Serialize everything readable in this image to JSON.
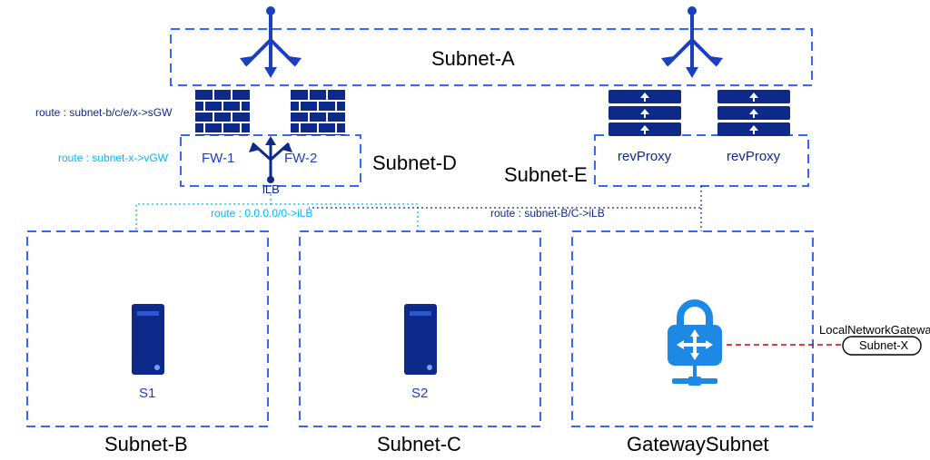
{
  "labels": {
    "subnetA": "Subnet-A",
    "subnetB": "Subnet-B",
    "subnetC": "Subnet-C",
    "subnetD": "Subnet-D",
    "subnetE": "Subnet-E",
    "gatewaySubnet": "GatewaySubnet",
    "fw1": "FW-1",
    "fw2": "FW-2",
    "ilb": "iLB",
    "revProxy1": "revProxy",
    "revProxy2": "revProxy",
    "s1": "S1",
    "s2": "S2",
    "localNetworkGateway": "LocalNetworkGateway",
    "subnetX": "Subnet-X"
  },
  "routes": {
    "sgw": "route : subnet-b/c/e/x->sGW",
    "vgw": "route : subnet-x->vGW",
    "default_ilb": "route : 0.0.0.0/0->iLB",
    "bc_ilb": "route : subnet-B/C->iLB"
  },
  "colors": {
    "primary": "#1b3fbf",
    "dash": "#3566ff",
    "cyan": "#00b7ff",
    "red": "#d40000"
  }
}
